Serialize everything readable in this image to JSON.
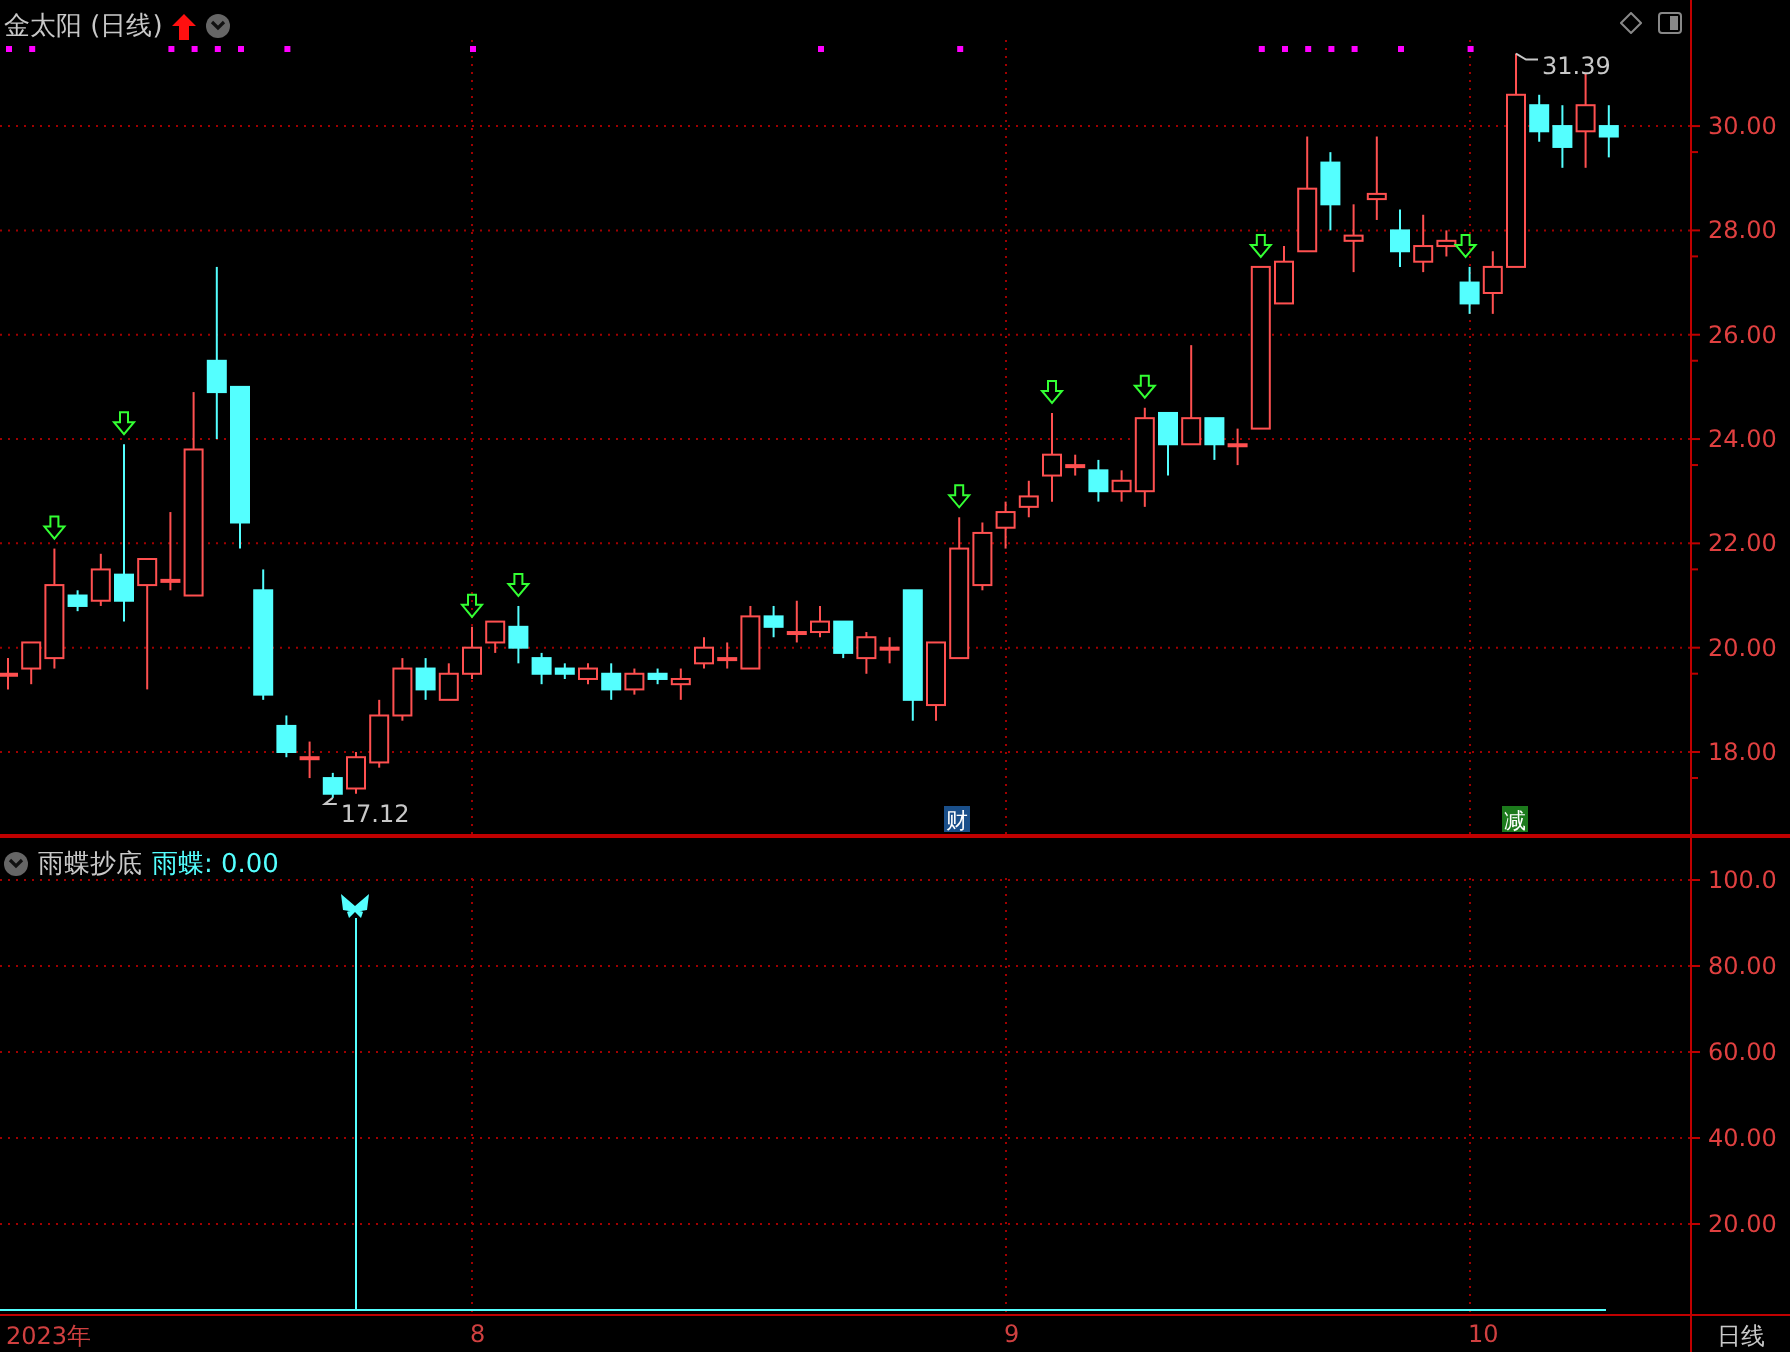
{
  "window": {
    "title": "金太阳 (日线)"
  },
  "price_pane": {
    "axis_labels": [
      "30.00",
      "28.00",
      "26.00",
      "24.00",
      "22.00",
      "20.00",
      "18.00"
    ],
    "high_label": "31.39",
    "low_label": "17.12",
    "event_badges": [
      {
        "text": "财",
        "kind": "finance"
      },
      {
        "text": "减",
        "kind": "reduction"
      }
    ]
  },
  "indicator_pane": {
    "name": "雨蝶抄底",
    "series_label": "雨蝶: 0.00",
    "axis_labels": [
      "100.0",
      "80.00",
      "60.00",
      "40.00",
      "20.00"
    ]
  },
  "time_axis": {
    "labels": [
      "2023年",
      "8",
      "9",
      "10"
    ],
    "period": "日线"
  }
}
